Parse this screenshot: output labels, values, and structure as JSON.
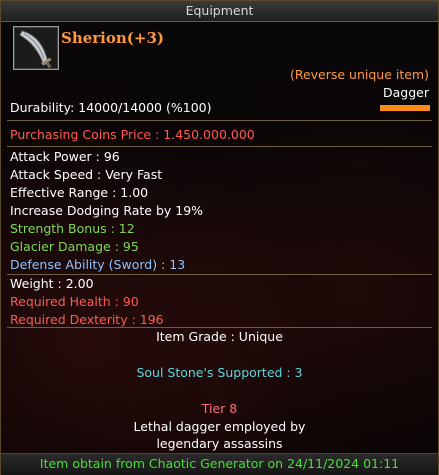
{
  "window": {
    "title": "Equipment"
  },
  "item": {
    "name": "Sherion(+3)",
    "tag": "(Reverse unique item)",
    "type": "Dagger",
    "icon": "dagger-icon",
    "durability": "Durability: 14000/14000 (%100)",
    "price": "Purchasing Coins Price : 1.450.000.000"
  },
  "stats": [
    "Attack Power : 96",
    "Attack Speed : Very Fast",
    "Effective Range : 1.00",
    "Increase Dodging Rate by 19%"
  ],
  "bonuses": {
    "strength": "Strength Bonus : 12",
    "glacier": "Glacier Damage : 95",
    "defense": "Defense Ability (Sword) : 13"
  },
  "requirements": {
    "weight": "Weight : 2.00",
    "health": "Required Health : 90",
    "dexterity": "Required Dexterity : 196"
  },
  "grade": "Item Grade : Unique",
  "soul_stone": "Soul Stone's Supported : 3",
  "tier": "Tier 8",
  "description": [
    "Lethal dagger employed by",
    "legendary assassins"
  ],
  "obtain": "Item obtain from Chaotic Generator on 24/11/2024 01:11",
  "colors": {
    "name": "#ff9a3c",
    "price": "#ff5a4f",
    "bonus": "#7ed957",
    "defense": "#8fc3ff",
    "requirement": "#ff5a4f",
    "soul": "#5fd4dc",
    "tier": "#ff6f7a",
    "obtain": "#44e038"
  }
}
